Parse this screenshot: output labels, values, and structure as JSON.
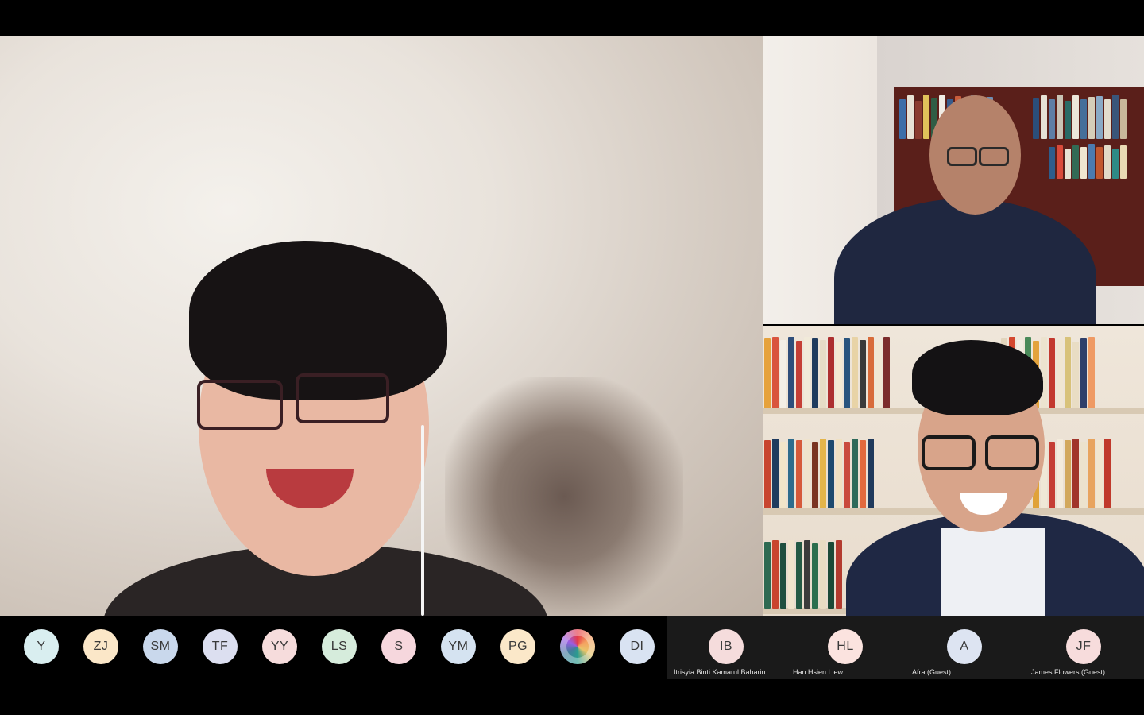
{
  "participants_strip": [
    {
      "initials": "Y",
      "color": "#d9eef0"
    },
    {
      "initials": "ZJ",
      "color": "#fbe7c8"
    },
    {
      "initials": "SM",
      "color": "#c9d8ec"
    },
    {
      "initials": "TF",
      "color": "#dcdff0"
    },
    {
      "initials": "YY",
      "color": "#f6dcdc"
    },
    {
      "initials": "LS",
      "color": "#d6ecdc"
    },
    {
      "initials": "S",
      "color": "#f6d7dd"
    },
    {
      "initials": "YM",
      "color": "#d5e3f1"
    },
    {
      "initials": "PG",
      "color": "#fbe8c9"
    },
    {
      "initials": "",
      "color": "multicolor"
    },
    {
      "initials": "DI",
      "color": "#d9e3f2"
    }
  ],
  "named_participants": [
    {
      "initials": "IB",
      "name": "Itrisyia Binti Kamarul Baharin",
      "color": "#f5dcdc"
    },
    {
      "initials": "HL",
      "name": "Han Hsien Liew",
      "color": "#fbe3df"
    },
    {
      "initials": "A",
      "name": "Afra (Guest)",
      "color": "#dde4f2"
    },
    {
      "initials": "JF",
      "name": "James Flowers (Guest)",
      "color": "#f7dcdc"
    }
  ]
}
